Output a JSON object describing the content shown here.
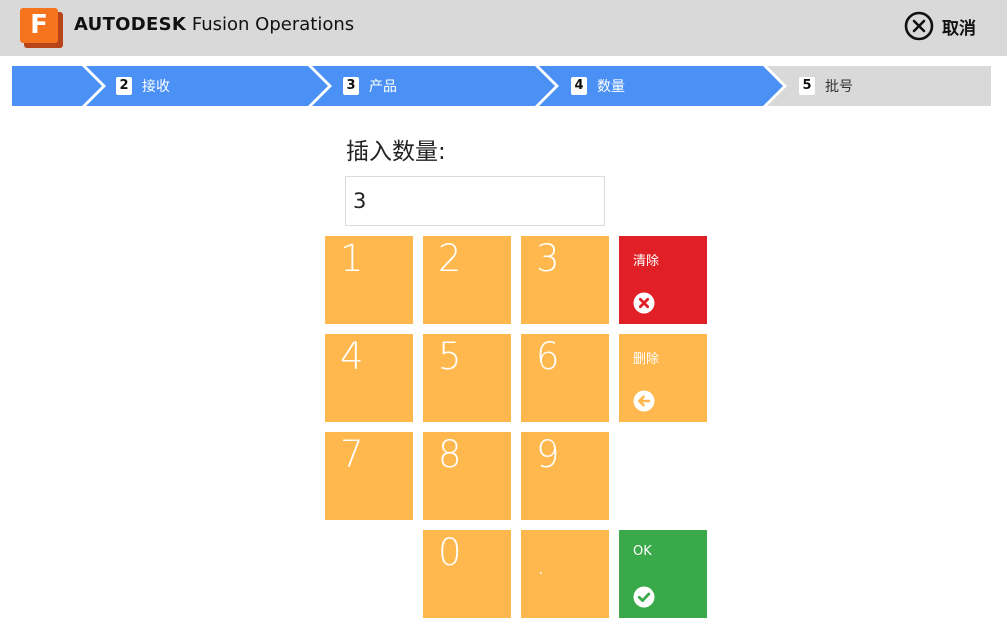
{
  "header": {
    "logo_letter": "F",
    "brand": "AUTODESK",
    "product": "Fusion Operations",
    "cancel_label": "取消"
  },
  "steps": [
    {
      "number": "",
      "label": "",
      "state": "done"
    },
    {
      "number": "2",
      "label": "接收",
      "state": "done"
    },
    {
      "number": "3",
      "label": "产品",
      "state": "done"
    },
    {
      "number": "4",
      "label": "数量",
      "state": "current"
    },
    {
      "number": "5",
      "label": "批号",
      "state": "pending"
    }
  ],
  "colors": {
    "step_active": "#4a90f5",
    "step_inactive": "#d9d9d9",
    "key": "#ffb84d",
    "clear": "#e02026",
    "ok": "#39a94a"
  },
  "form": {
    "prompt": "插入数量:",
    "value": "3"
  },
  "keypad": {
    "keys": [
      "1",
      "2",
      "3",
      "4",
      "5",
      "6",
      "7",
      "8",
      "9",
      "0",
      "."
    ],
    "clear_label": "清除",
    "delete_label": "删除",
    "ok_label": "OK"
  }
}
